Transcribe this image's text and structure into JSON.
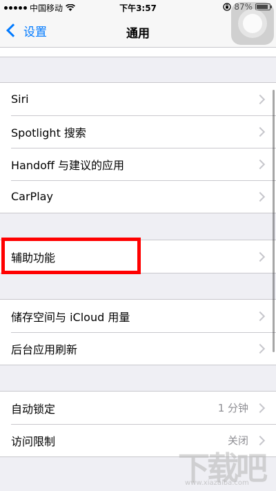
{
  "status_bar": {
    "carrier": "中国移动",
    "time": "下午3:57",
    "battery_percent": "87%",
    "battery_level": 0.87
  },
  "nav": {
    "back_label": "设置",
    "title": "通用"
  },
  "groups": [
    {
      "items": [
        {
          "label": "Siri"
        },
        {
          "label": "Spotlight 搜索"
        },
        {
          "label": "Handoff 与建议的应用"
        },
        {
          "label": "CarPlay"
        }
      ]
    },
    {
      "items": [
        {
          "label": "辅助功能"
        }
      ]
    },
    {
      "items": [
        {
          "label": "储存空间与 iCloud 用量"
        },
        {
          "label": "后台应用刷新"
        }
      ]
    },
    {
      "items": [
        {
          "label": "自动锁定",
          "value": "1 分钟"
        },
        {
          "label": "访问限制",
          "value": "关闭"
        }
      ]
    }
  ],
  "watermark": {
    "text": "下载吧",
    "sub": "www.xiazaiba.com"
  },
  "colors": {
    "accent": "#007aff",
    "highlight": "#ff0000",
    "background": "#efeff4"
  }
}
